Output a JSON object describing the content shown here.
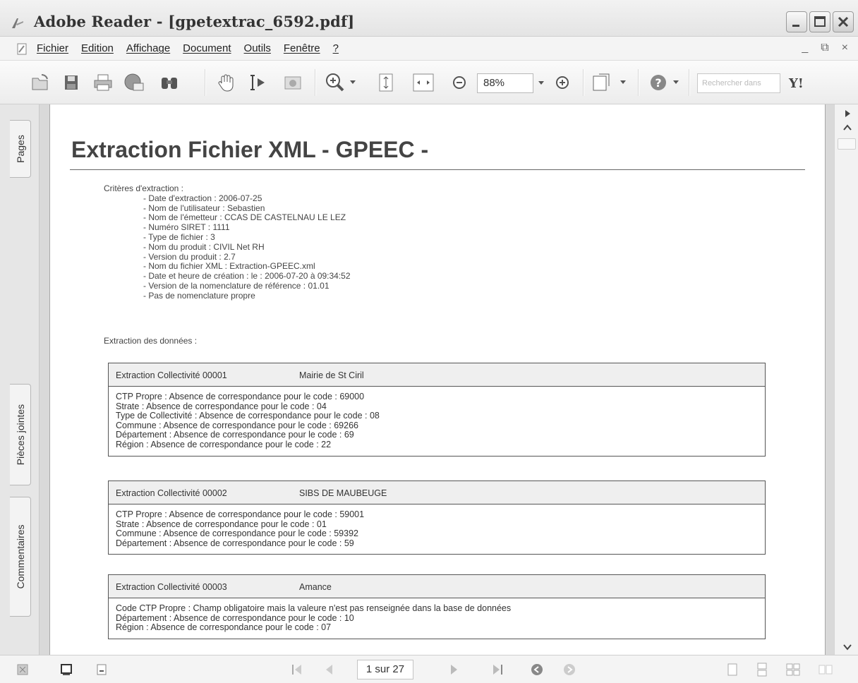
{
  "window": {
    "title": "Adobe Reader - [gpetextrac_6592.pdf]",
    "controls": {
      "minimize_icon": "minimize-icon",
      "maximize_icon": "maximize-icon",
      "close_icon": "close-icon"
    }
  },
  "menu": {
    "items": [
      "Fichier",
      "Edition",
      "Affichage",
      "Document",
      "Outils",
      "Fenêtre",
      "?"
    ],
    "right_controls": [
      "_",
      "⧉",
      "×"
    ]
  },
  "toolbar": {
    "zoom_value": "88%",
    "search_placeholder": "Rechercher dans",
    "yahoo_label": "Y!",
    "icons": [
      "open-icon",
      "save-icon",
      "print-icon",
      "email-icon",
      "search-binoculars-icon",
      "hand-tool-icon",
      "select-text-icon",
      "snapshot-icon",
      "zoom-in-tool-icon",
      "fit-page-icon",
      "fit-width-icon",
      "zoom-out-icon",
      "zoom-plus-icon",
      "pages-menu-icon",
      "help-icon"
    ]
  },
  "sidebar": {
    "tabs": [
      "Pages",
      "Pièces jointes",
      "Commentaires"
    ]
  },
  "document": {
    "title": "Extraction Fichier XML - GPEEC -",
    "criteria_heading": "Critères d'extraction :",
    "criteria": [
      "- Date d'extraction : 2006-07-25",
      "- Nom de l'utilisateur : Sebastien",
      "- Nom de l'émetteur : CCAS DE CASTELNAU LE LEZ",
      "- Numéro SIRET : 1111",
      "- Type de fichier : 3",
      "- Nom du produit : CIVIL Net RH",
      "- Version du produit : 2.7",
      "- Nom du fichier XML : Extraction-GPEEC.xml",
      "- Date et heure de création : le : 2006-07-20  à  09:34:52",
      "- Version de la nomenclature de référence : 01.01",
      "- Pas de nomenclature propre"
    ],
    "extraction_label": "Extraction des données :",
    "blocks": [
      {
        "id": "Extraction Collectivité 00001",
        "name": "Mairie de St Ciril",
        "lines": [
          "CTP Propre : Absence de correspondance pour le code : 69000",
          "Strate : Absence de correspondance pour le code : 04",
          "Type de Collectivité : Absence de correspondance pour le code : 08",
          "Commune : Absence de correspondance pour le code : 69266",
          "Département : Absence de correspondance pour le code : 69",
          "Région : Absence de correspondance pour le code : 22"
        ]
      },
      {
        "id": "Extraction Collectivité 00002",
        "name": "SIBS DE MAUBEUGE",
        "lines": [
          "CTP Propre : Absence de correspondance pour le code : 59001",
          "Strate : Absence de correspondance pour le code : 01",
          "Commune : Absence de correspondance pour le code : 59392",
          "Département : Absence de correspondance pour le code : 59"
        ]
      },
      {
        "id": "Extraction Collectivité 00003",
        "name": "Amance",
        "lines": [
          "Code CTP Propre : Champ obligatoire mais la valeure n'est pas renseignée dans la base de données",
          "Département : Absence de correspondance pour le code : 10",
          "Région : Absence de correspondance pour le code : 07"
        ]
      }
    ]
  },
  "statusbar": {
    "page_indicator": "1 sur 27"
  }
}
